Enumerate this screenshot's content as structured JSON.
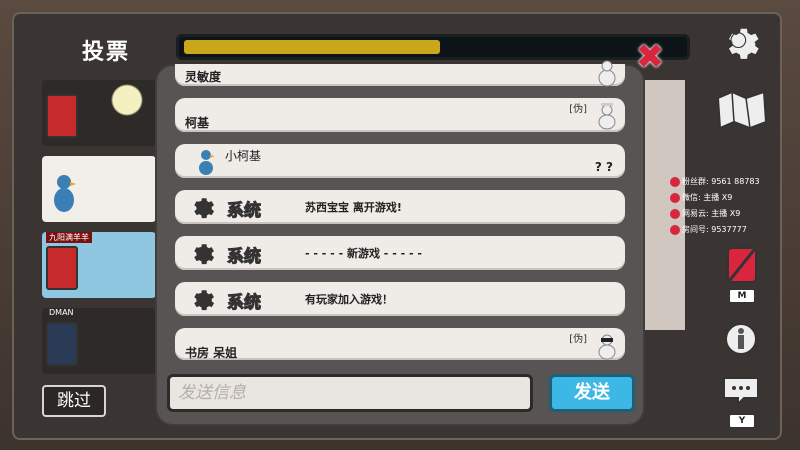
{
  "screen": {
    "title": "投票"
  },
  "vote_progress": {
    "fill_fraction": 0.51
  },
  "players": [
    {
      "label": ""
    },
    {
      "label": ""
    },
    {
      "label": "九阳满羊羊"
    },
    {
      "label": "DMAN"
    }
  ],
  "skip_label": "跳过",
  "chat": {
    "messages": [
      {
        "sender": "灵敏度",
        "body": "",
        "badge": ""
      },
      {
        "sender": "柯基",
        "body": "",
        "badge": "[伪]"
      },
      {
        "sender": "小柯基",
        "body": "? ?",
        "badge": ""
      },
      {
        "sender": "系统",
        "body": "苏西宝宝 离开游戏!",
        "badge": ""
      },
      {
        "sender": "系统",
        "body": "- - - - - 新游戏 - - - - -",
        "badge": ""
      },
      {
        "sender": "系统",
        "body": "有玩家加入游戏！",
        "badge": ""
      },
      {
        "sender": "书房 呆姐",
        "body": "",
        "badge": "[伪]"
      }
    ],
    "input_placeholder": "发送信息",
    "send_label": "发送"
  },
  "side_keys": {
    "mute": "M",
    "chat": "Y"
  },
  "stream_info": {
    "fans": "粉丝群: 9561 88783",
    "wechat": "微信: 主播 X9",
    "netease": "网易云: 主播 X9",
    "room": "房间号: 9537777"
  },
  "colors": {
    "accent": "#3cb7e6",
    "system_label": "#f2ea3c",
    "close": "#d9253d",
    "progress": "#c9a61a"
  }
}
